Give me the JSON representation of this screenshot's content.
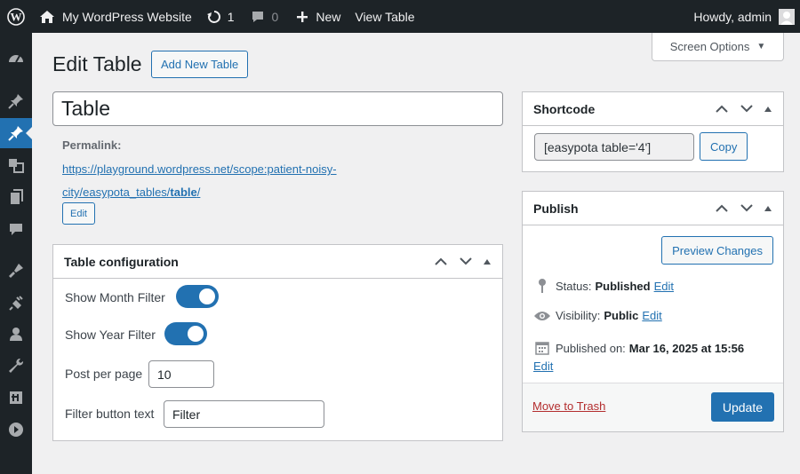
{
  "admin_bar": {
    "site_name": "My WordPress Website",
    "updates_count": "1",
    "comments_count": "0",
    "new_label": "New",
    "view_label": "View Table",
    "howdy": "Howdy, admin"
  },
  "sidebar": {
    "items": [
      {
        "icon": "dashboard-icon"
      },
      {
        "icon": "posts-icon"
      },
      {
        "icon": "tables-icon",
        "active": true
      },
      {
        "icon": "media-icon"
      },
      {
        "icon": "pages-icon"
      },
      {
        "icon": "comments-icon"
      },
      {
        "icon": "appearance-icon"
      },
      {
        "icon": "plugins-icon"
      },
      {
        "icon": "users-icon"
      },
      {
        "icon": "tools-icon"
      },
      {
        "icon": "settings-icon"
      },
      {
        "icon": "collapse-icon"
      }
    ]
  },
  "screen_options": "Screen Options",
  "header": {
    "title": "Edit Table",
    "add_new": "Add New Table"
  },
  "post_title": "Table",
  "permalink": {
    "label": "Permalink:",
    "url_line1": "https://playground.wordpress.net/scope:patient-noisy-",
    "url_line2_prefix": "city/easypota_tables/",
    "url_slug": "table",
    "url_suffix": "/",
    "edit_label": "Edit"
  },
  "table_config": {
    "title": "Table configuration",
    "show_month_label": "Show Month Filter",
    "show_month_on": true,
    "show_year_label": "Show Year Filter",
    "show_year_on": true,
    "per_page_label": "Post per page",
    "per_page_value": "10",
    "filter_button_label": "Filter button text",
    "filter_button_value": "Filter"
  },
  "shortcode": {
    "title": "Shortcode",
    "value": "[easypota table='4']",
    "copy_label": "Copy"
  },
  "publish": {
    "title": "Publish",
    "preview_label": "Preview Changes",
    "status_label": "Status:",
    "status_value": "Published",
    "visibility_label": "Visibility:",
    "visibility_value": "Public",
    "published_on_label": "Published on:",
    "published_on_value": "Mar 16, 2025 at 15:56",
    "edit_label": "Edit",
    "trash_label": "Move to Trash",
    "update_label": "Update"
  }
}
